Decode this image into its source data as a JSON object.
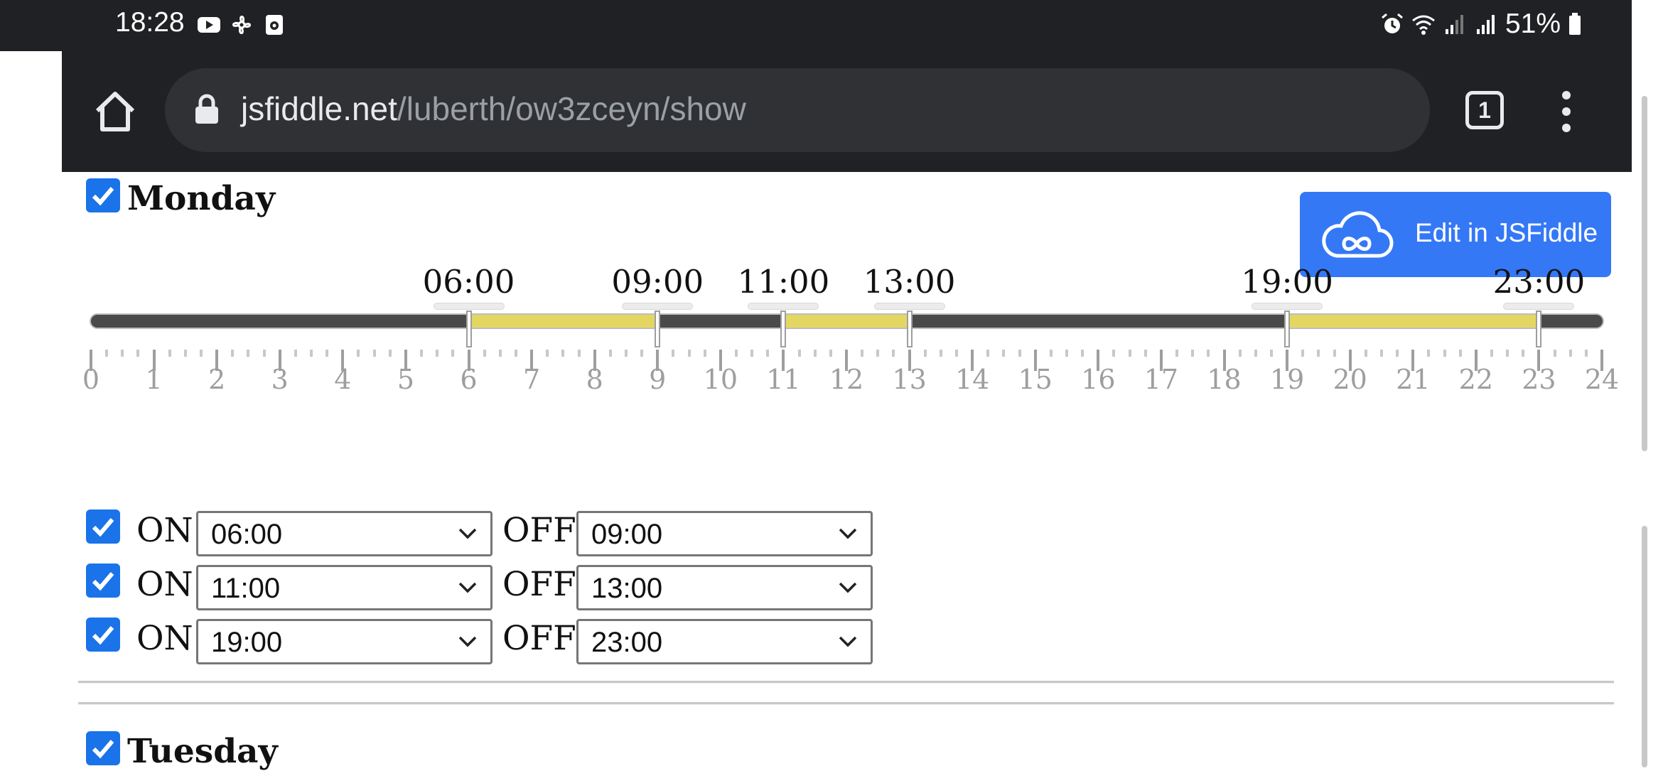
{
  "status_bar": {
    "time": "18:28",
    "left_icons": [
      "youtube-icon",
      "fan-icon",
      "app-icon"
    ],
    "right_icons": [
      "alarm-icon",
      "wifi-icon",
      "signal-icon",
      "signal-icon"
    ],
    "battery": "51%"
  },
  "browser": {
    "url_domain": "jsfiddle.net",
    "url_path": "/luberth/ow3zceyn/show",
    "tab_count": "1"
  },
  "edit_button": {
    "label": "Edit in JSFiddle"
  },
  "monday": {
    "label": "Monday",
    "checked": true,
    "handles": [
      "06:00",
      "09:00",
      "11:00",
      "13:00",
      "19:00",
      "23:00"
    ],
    "ticks": [
      "0",
      "1",
      "2",
      "3",
      "4",
      "5",
      "6",
      "7",
      "8",
      "9",
      "10",
      "11",
      "12",
      "13",
      "14",
      "15",
      "16",
      "17",
      "18",
      "19",
      "20",
      "21",
      "22",
      "23",
      "24"
    ],
    "ranges": [
      {
        "on": 6,
        "off": 9
      },
      {
        "on": 11,
        "off": 13
      },
      {
        "on": 19,
        "off": 23
      }
    ],
    "rows": [
      {
        "checked": true,
        "on_label": "ON",
        "on_value": "06:00",
        "off_label": "OFF",
        "off_value": "09:00"
      },
      {
        "checked": true,
        "on_label": "ON",
        "on_value": "11:00",
        "off_label": "OFF",
        "off_value": "13:00"
      },
      {
        "checked": true,
        "on_label": "ON",
        "on_value": "19:00",
        "off_label": "OFF",
        "off_value": "23:00"
      }
    ]
  },
  "tuesday": {
    "label": "Tuesday",
    "checked": true
  },
  "colors": {
    "range_fill": "#e4d761",
    "track": "#4a4a4a",
    "checkbox": "#1a73e8",
    "edit_button": "#3478f6"
  }
}
